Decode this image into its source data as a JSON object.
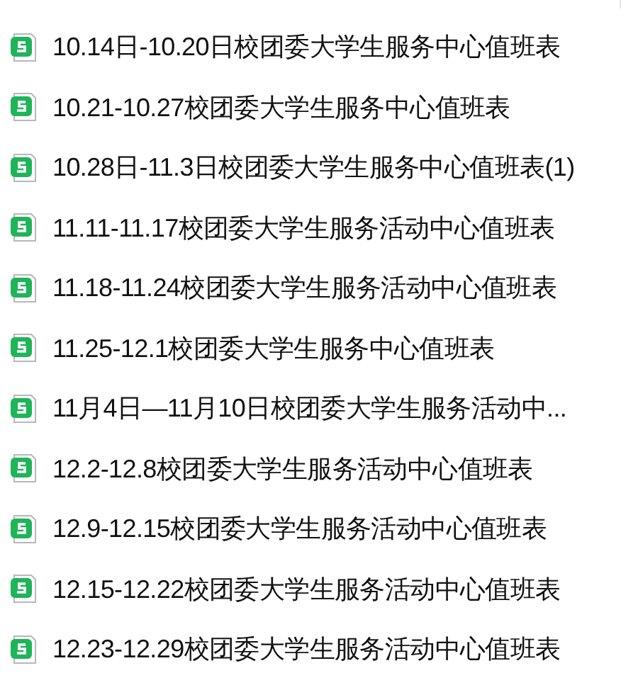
{
  "files": [
    {
      "name": "10.14日-10.20日校团委大学生服务中心值班表"
    },
    {
      "name": "10.21-10.27校团委大学生服务中心值班表"
    },
    {
      "name": "10.28日-11.3日校团委大学生服务中心值班表(1)"
    },
    {
      "name": "11.11-11.17校团委大学生服务活动中心值班表"
    },
    {
      "name": "11.18-11.24校团委大学生服务活动中心值班表"
    },
    {
      "name": "11.25-12.1校团委大学生服务中心值班表"
    },
    {
      "name": "11月4日—11月10日校团委大学生服务活动中..."
    },
    {
      "name": "12.2-12.8校团委大学生服务活动中心值班表"
    },
    {
      "name": "12.9-12.15校团委大学生服务活动中心值班表"
    },
    {
      "name": "12.15-12.22校团委大学生服务活动中心值班表"
    },
    {
      "name": "12.23-12.29校团委大学生服务活动中心值班表"
    }
  ]
}
